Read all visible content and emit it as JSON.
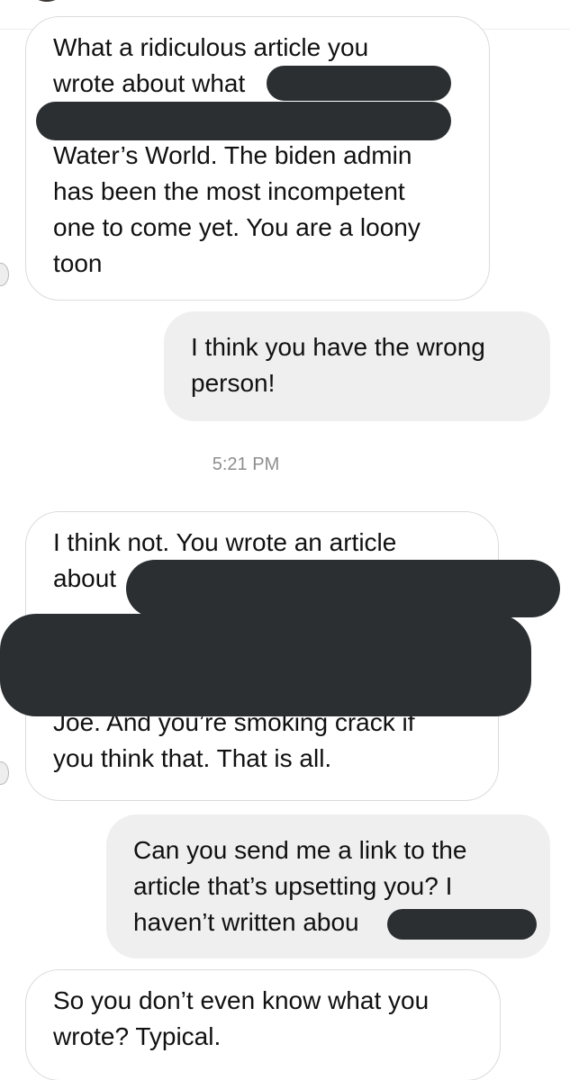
{
  "timestamp": "5:21 PM",
  "messages": [
    {
      "sender": "them",
      "lines": [
        "What a ridiculous article you",
        "wrote about what",
        "",
        "Water’s World. The biden admin",
        "has been the most incompetent",
        "one to come yet. You are a loony",
        "toon"
      ]
    },
    {
      "sender": "me",
      "lines": [
        "I think you have the wrong",
        "person!"
      ]
    },
    {
      "sender": "them",
      "lines": [
        "I think not. You wrote an article",
        "about",
        "",
        "",
        "",
        "Joe. And you’re smoking crack if",
        "you think that. That is all."
      ]
    },
    {
      "sender": "me",
      "lines": [
        "Can you send me a link to the",
        "article that’s upsetting you? I",
        "haven’t written abou"
      ]
    },
    {
      "sender": "them",
      "lines": [
        "So you don’t even know what you",
        "wrote? Typical."
      ]
    }
  ],
  "colors": {
    "incoming_bubble": "#ffffff",
    "incoming_border": "#dbdbdb",
    "outgoing_bubble": "#efefef",
    "redaction": "#2b2f32",
    "timestamp_text": "#8e8e8e"
  },
  "icons": {
    "profile": "avatar",
    "redaction": "redaction-bar"
  }
}
